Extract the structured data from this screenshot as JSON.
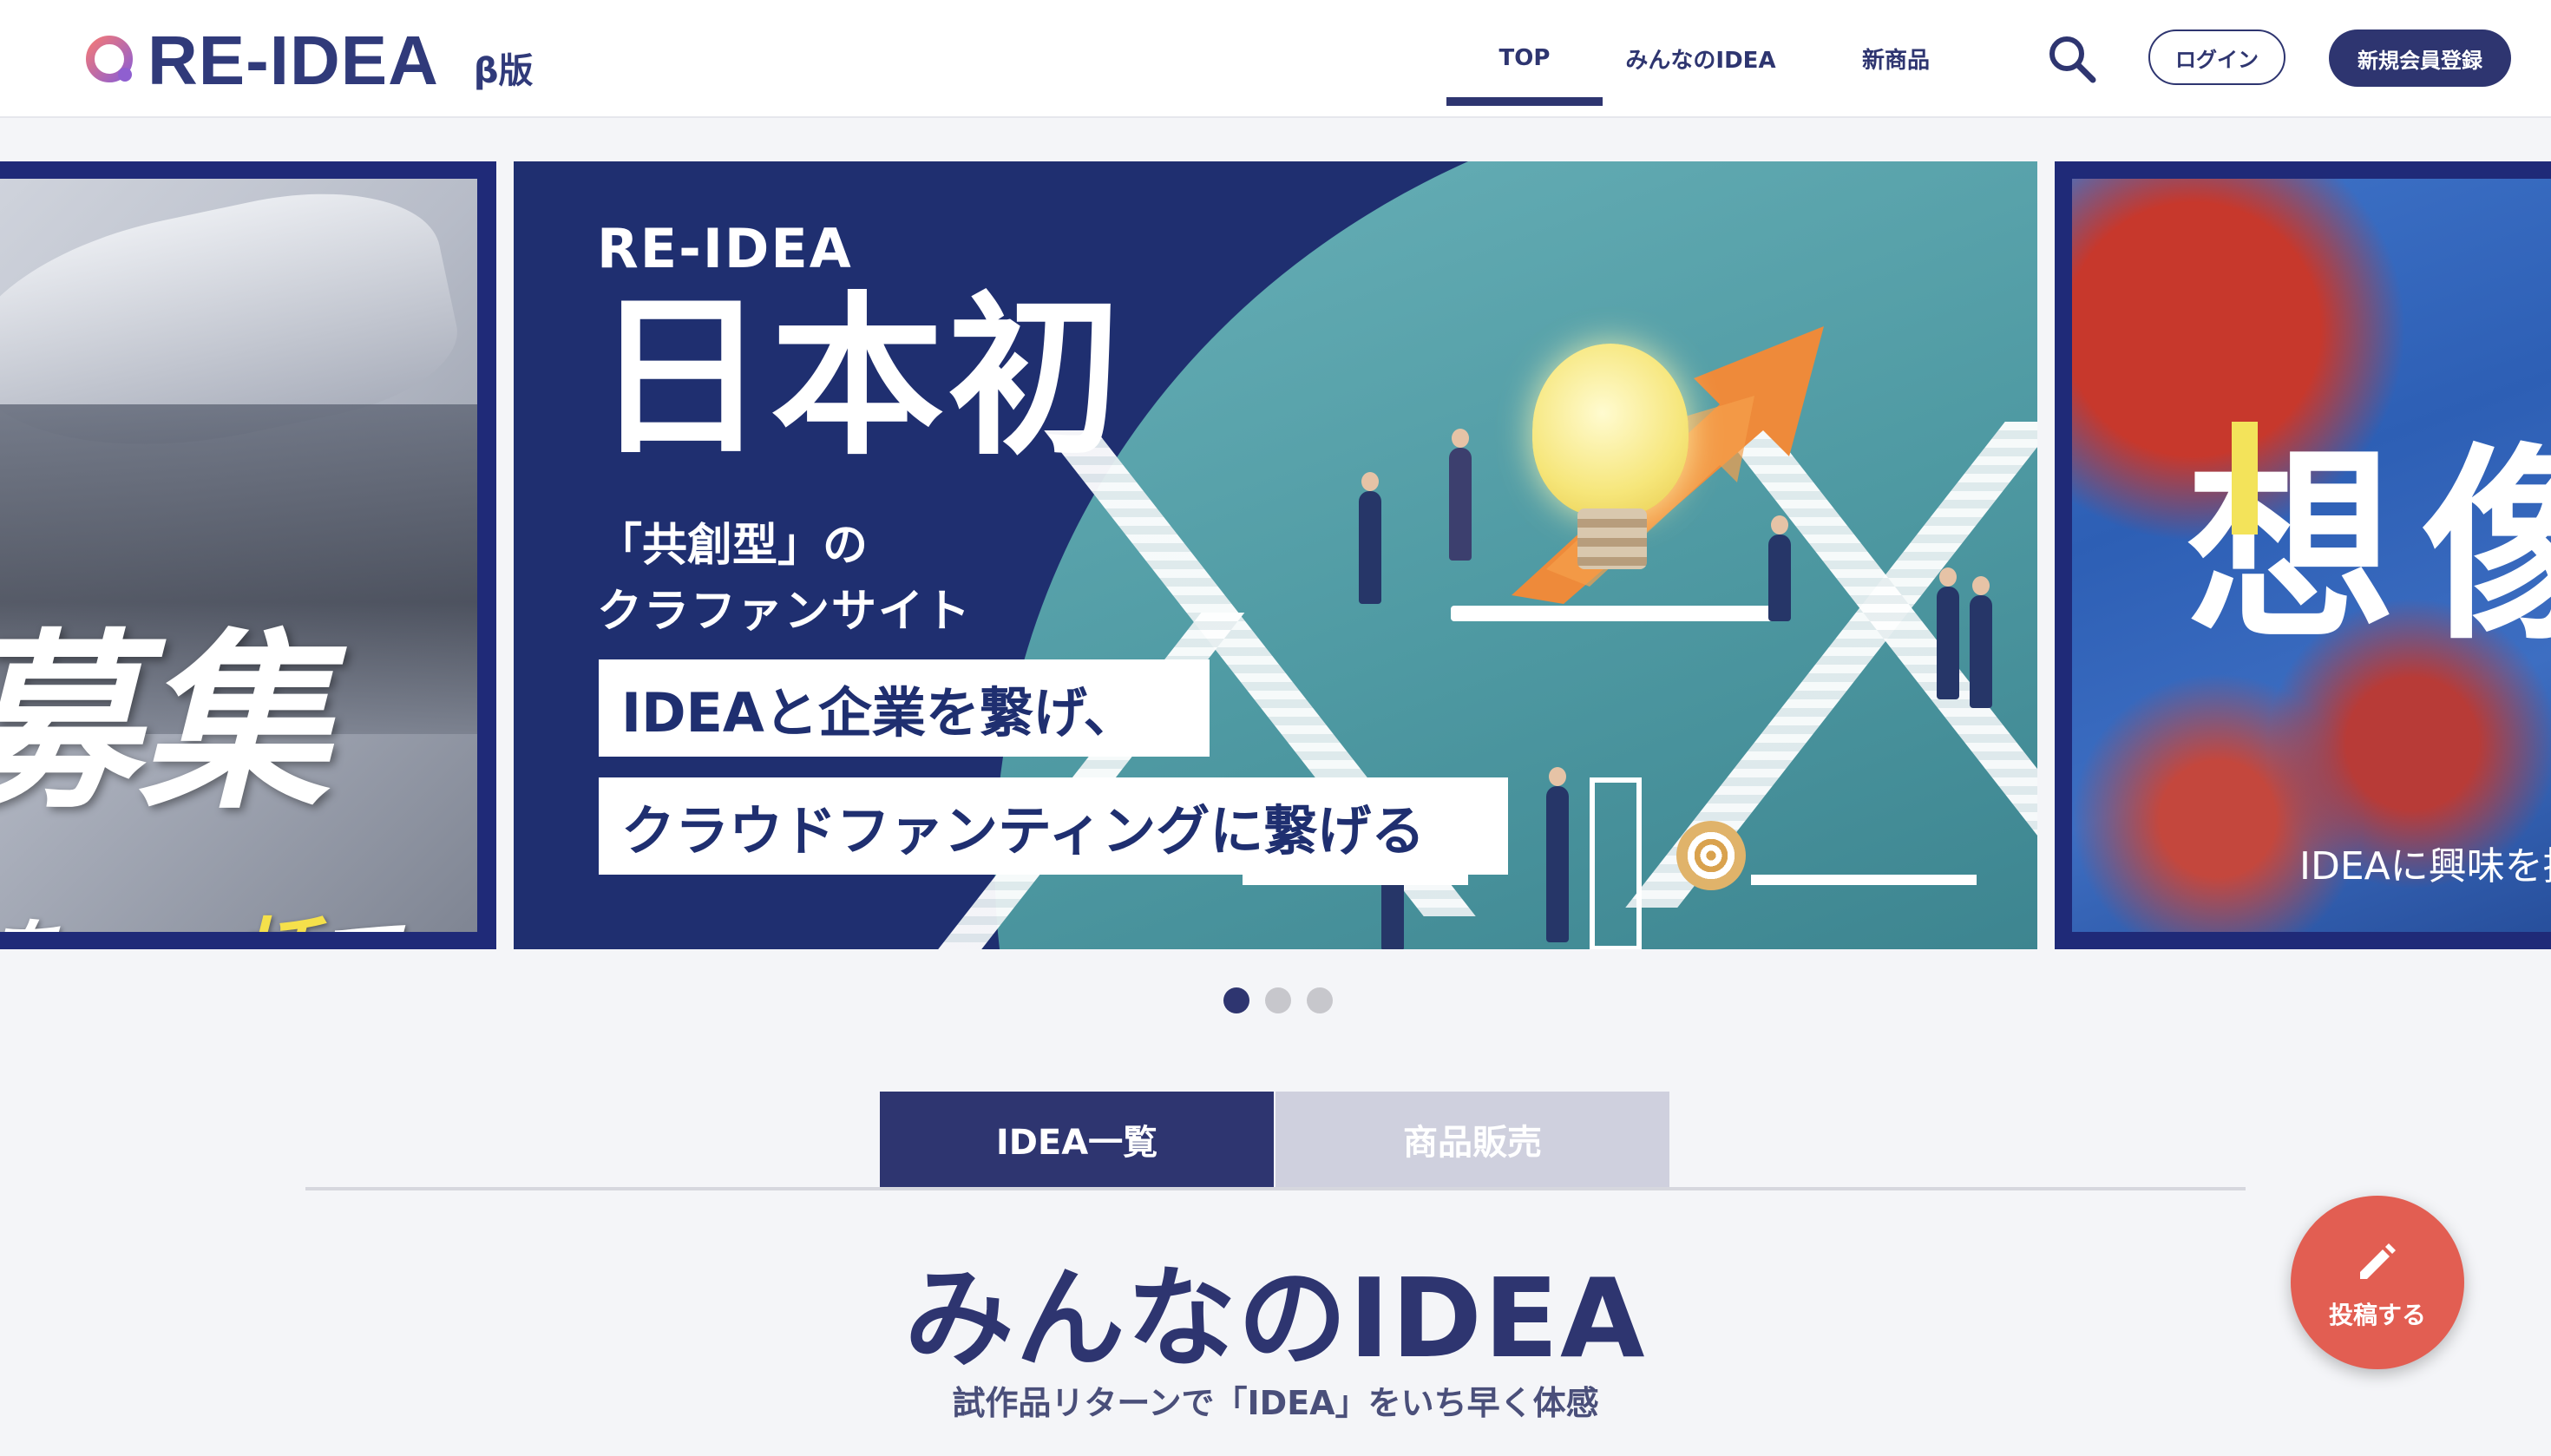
{
  "header": {
    "logo_text": "RE-IDEA",
    "beta_label": "β版",
    "nav": {
      "top": "TOP",
      "ideas": "みんなのIDEA",
      "new_products": "新商品"
    },
    "login": "ログイン",
    "register": "新規会員登録"
  },
  "carousel": {
    "left": {
      "headline": "募集",
      "sub_prefix": "を、",
      "sub_highlight": "一括",
      "sub_suffix": "で。"
    },
    "main": {
      "brand": "RE-IDEA",
      "title": "日本初",
      "sub1": "「共創型」の",
      "sub2": "クラファンサイト",
      "band1": "IDEAと企業を繋げ、",
      "band2": "クラウドファンティングに繋げる"
    },
    "right": {
      "headline": "想像",
      "sub": "IDEAに興味を持"
    },
    "active_index": 1
  },
  "tabs": {
    "ideas": "IDEA一覧",
    "shop": "商品販売"
  },
  "section": {
    "title": "みんなのIDEA",
    "subtitle": "試作品リターンで「IDEA」をいち早く体感"
  },
  "fab": {
    "label": "投稿する"
  },
  "colors": {
    "brand": "#2e3570",
    "accent": "#e25e52",
    "highlight": "#f5e04b"
  }
}
